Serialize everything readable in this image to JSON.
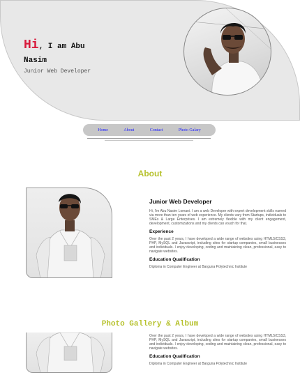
{
  "hero": {
    "greeting_big": "Hi",
    "greeting_rest": ", I am Abu",
    "name_line2": "Nasim",
    "role": "Junior Web Developer"
  },
  "nav": {
    "items": [
      "Home",
      "About",
      "Contact",
      "Photo Galary"
    ]
  },
  "about": {
    "title": "About",
    "heading": "Junior Web Developer",
    "bio": "Hi, I'm Abu Nasim Lomani. I am a web Developer with expert development skills earned via more than ten years of web experience. My clients vary from Startups, individuals to SMEs & Large Enterprises. I am extremely flexible with my client engagement, development, customizations and my clients can vouch for that.",
    "experience_title": "Experience",
    "experience_text": "Over the past 2 years, I have developed a wide range of websites using HTML5/CSS3, PHP, MySQL and Javascript, including sites for startup companies, small businesses and individuals. I enjoy developing, coding and maintaining clean, professional, easy to navigate websites.",
    "education_title": "Education Qualification",
    "education_text": "Diploma in Computer Engineer at Barguna Polytechnic Institute"
  },
  "gallery": {
    "title": "Photo Gallery & Album",
    "experience_text": "Over the past 2 years, I have developed a wide range of websites using HTML5/CSS3, PHP, MySQL and Javascript, including sites for startup companies, small businesses and individuals. I enjoy developing, coding and maintaining clean, professional, easy to navigate websites.",
    "education_title": "Education Qualification",
    "education_text": "Diploma in Computer Engineer at Barguna Polytechnic Institute"
  },
  "colors": {
    "accent_red": "#d81b3c",
    "section_title": "#b7c22f",
    "nav_link": "#1a1aff"
  }
}
